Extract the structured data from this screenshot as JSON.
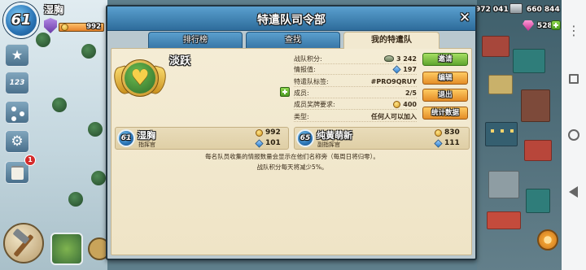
{
  "hud": {
    "player": {
      "level": "61",
      "name": "湿胸",
      "medals": "992"
    },
    "resources": {
      "stone": "972 041",
      "iron": "660 844",
      "diamonds": "528"
    },
    "side_menu": {
      "leaderboard_glyph": "123",
      "notification_count": "1"
    }
  },
  "modal": {
    "title": "特遣队司令部",
    "close_glyph": "✕",
    "tabs": [
      {
        "label": "排行榜",
        "active": false
      },
      {
        "label": "查找",
        "active": false
      },
      {
        "label": "我的特遣队",
        "active": true
      }
    ],
    "taskforce": {
      "name": "淡跃",
      "info": [
        {
          "label": "战队积分:",
          "value": "3 242",
          "icon": "victory-points-icon"
        },
        {
          "label": "情报值:",
          "value": "197",
          "icon": "intel-icon"
        },
        {
          "label": "特遣队标签:",
          "value": "#PRO9QRUY"
        },
        {
          "label": "成员:",
          "value": "2/5"
        },
        {
          "label": "成员奖牌要求:",
          "value": "400",
          "icon": "medal-icon"
        },
        {
          "label": "类型:",
          "value": "任何人可以加入"
        }
      ]
    },
    "actions": {
      "invite": "邀请",
      "edit": "编辑",
      "leave": "退出",
      "stats": "统计数据"
    },
    "members": [
      {
        "level": "61",
        "name": "湿胸",
        "role": "指挥官",
        "medals": "992",
        "intel": "101"
      },
      {
        "level": "65",
        "name": "纯黄萌新",
        "role": "副指挥官",
        "medals": "830",
        "intel": "111"
      }
    ],
    "notes": [
      "每名队员收集的情报数量会显示在他们名称旁（每周日将归零）。",
      "战队积分每天将减少5%。"
    ]
  },
  "colors": {
    "header_blue": "#3f86b6",
    "parchment": "#f2e9d0",
    "invite_green": "#7bc043",
    "action_orange": "#f0a233",
    "level_blue": "#2f7fc4",
    "notification_red": "#d42b2b"
  },
  "icons": {
    "top_left": [
      "level-badge-icon",
      "rank-shield-icon",
      "medal-icon"
    ],
    "resources": [
      "stone-icon",
      "diamond-icon",
      "add-diamonds-icon"
    ],
    "side_menu": [
      "star-icon",
      "leaderboard-icon",
      "network-icon",
      "gear-icon",
      "logbook-icon"
    ],
    "nav": [
      "menu-icon",
      "recents-icon",
      "home-icon",
      "back-icon"
    ]
  }
}
